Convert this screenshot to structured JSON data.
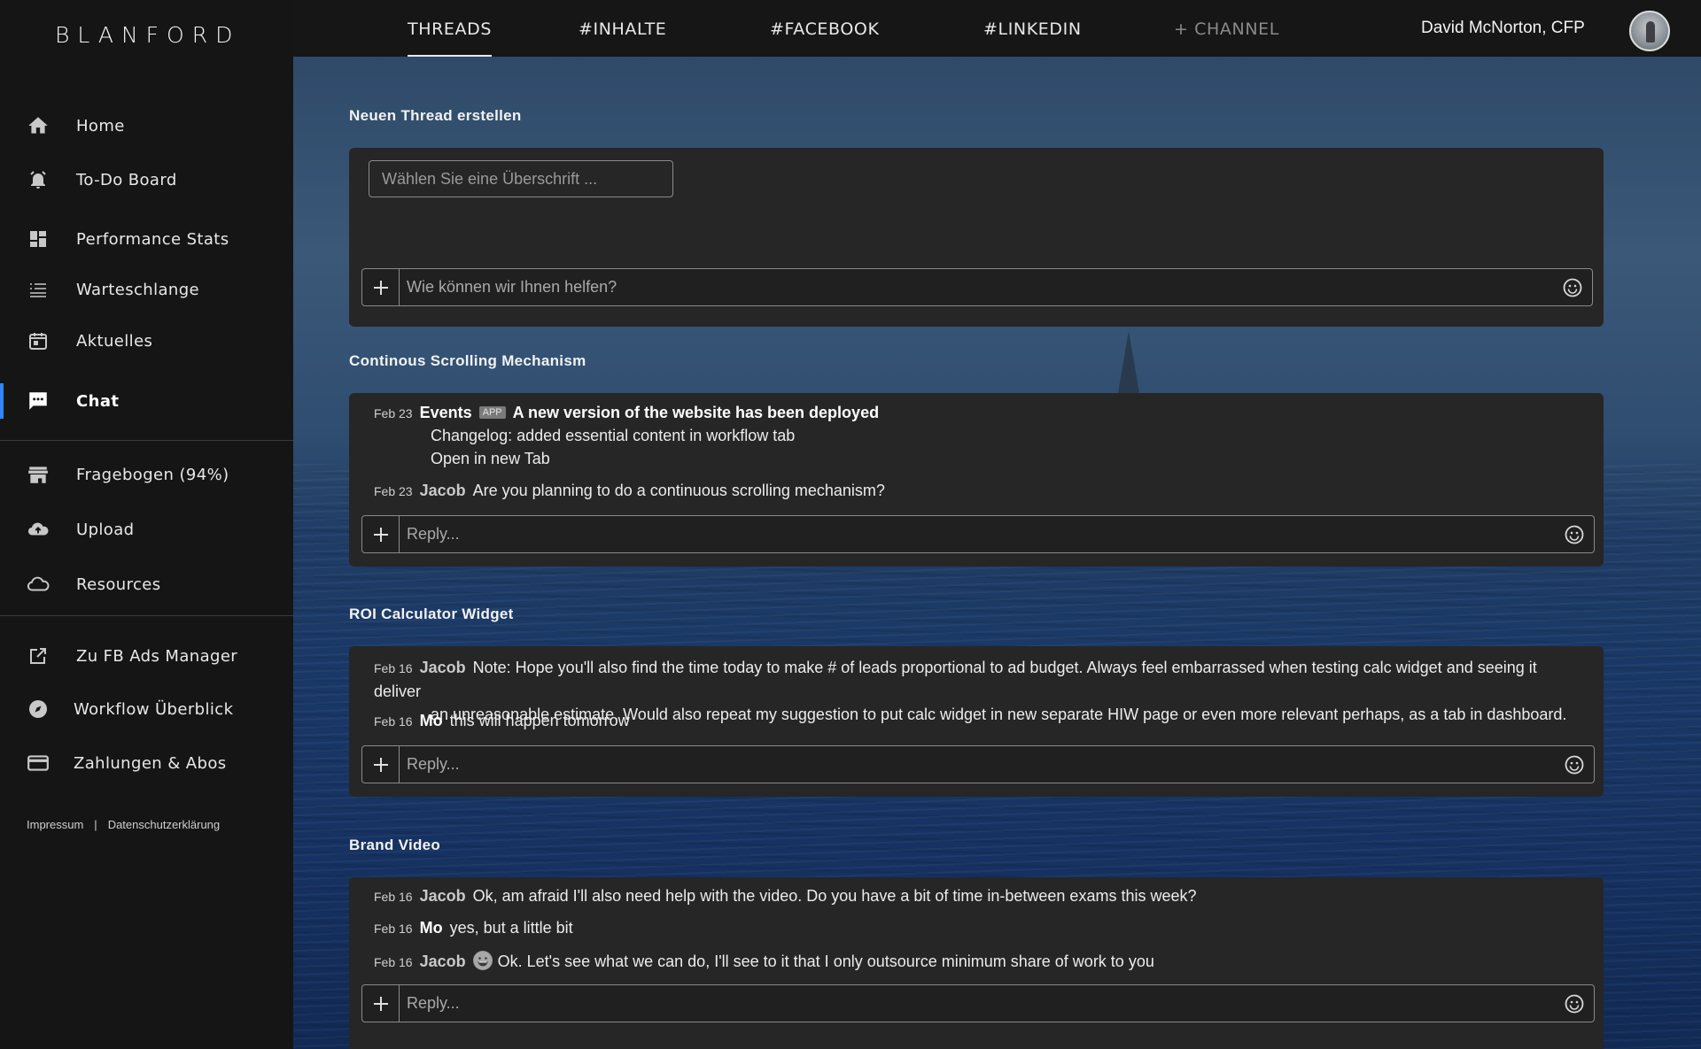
{
  "app": {
    "logo": "BLANFORD"
  },
  "sidebar": {
    "items": [
      {
        "label": "Home",
        "icon": "home-icon"
      },
      {
        "label": "To-Do Board",
        "icon": "alarm-icon"
      },
      {
        "label": "Performance Stats",
        "icon": "dashboard-icon"
      },
      {
        "label": "Warteschlange",
        "icon": "queue-list-icon"
      },
      {
        "label": "Aktuelles",
        "icon": "calendar-icon"
      },
      {
        "label": "Chat",
        "icon": "chat-icon",
        "active": true
      },
      {
        "label": "Fragebogen (94%)",
        "icon": "store-icon"
      },
      {
        "label": "Upload",
        "icon": "cloud-upload-icon"
      },
      {
        "label": "Resources",
        "icon": "cloud-icon"
      },
      {
        "label": "Zu FB Ads Manager",
        "icon": "external-link-icon"
      },
      {
        "label": "Workflow Überblick",
        "icon": "compass-icon"
      },
      {
        "label": "Zahlungen & Abos",
        "icon": "credit-card-icon"
      }
    ],
    "footer": {
      "impressum": "Impressum",
      "separator": "|",
      "privacy": "Datenschutzerklärung"
    }
  },
  "topbar": {
    "tabs": [
      {
        "label": "THREADS",
        "active": true
      },
      {
        "label": "#INHALTE"
      },
      {
        "label": "#FACEBOOK"
      },
      {
        "label": "#LINKEDIN"
      },
      {
        "label": "+ CHANNEL",
        "muted": true
      }
    ],
    "user": {
      "name": "David McNorton, CFP"
    }
  },
  "new_thread": {
    "title": "Neuen Thread erstellen",
    "title_placeholder": "Wählen Sie eine Überschrift ...",
    "message_placeholder": "Wie können wir Ihnen helfen?"
  },
  "threads": [
    {
      "title": "Continous Scrolling Mechanism",
      "messages": [
        {
          "date": "Feb 23",
          "author": "Events",
          "badge": "APP",
          "text": "A new version of the website has been deployed",
          "lines": [
            "Changelog: added essential content in workflow tab",
            "Open in new Tab"
          ]
        },
        {
          "date": "Feb 23",
          "author": "Jacob",
          "text": "Are you planning to do a continuous scrolling mechanism?"
        }
      ],
      "reply_placeholder": "Reply..."
    },
    {
      "title": "ROI Calculator Widget",
      "messages": [
        {
          "date": "Feb 16",
          "author": "Jacob",
          "text": "Note: Hope you'll also find the time today to make # of leads proportional to ad budget. Always feel embarrassed when testing calc widget and seeing it deliver",
          "continuation": "an unreasonable estimate. Would also repeat my suggestion to put calc widget in new separate HIW page or even more relevant perhaps, as a tab in dashboard."
        },
        {
          "date": "Feb 16",
          "author": "Mo",
          "text": "this will happen tomorrow"
        }
      ],
      "reply_placeholder": "Reply..."
    },
    {
      "title": "Brand Video",
      "messages": [
        {
          "date": "Feb 16",
          "author": "Jacob",
          "text": "Ok, am afraid I'll also need help with the video. Do you have a bit of time in-between exams this week?"
        },
        {
          "date": "Feb 16",
          "author": "Mo",
          "text": "yes, but a little bit"
        },
        {
          "date": "Feb 16",
          "author": "Jacob",
          "emoji": "grinning-face-icon",
          "text": "Ok. Let's see what we can do, I'll see to it that I only outsource minimum share of work to you"
        }
      ],
      "reply_placeholder": "Reply..."
    }
  ],
  "colors": {
    "sidebar_bg": "#151515",
    "card_bg": "#262626",
    "accent": "#2f86f6",
    "sea_blue": "#1a3867"
  }
}
